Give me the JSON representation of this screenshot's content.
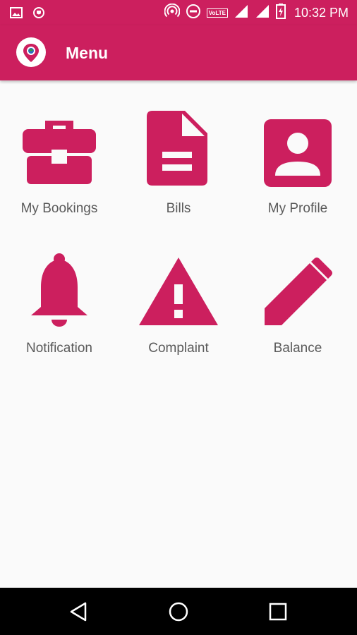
{
  "status_bar": {
    "time": "10:32 PM",
    "network_badge": "VoLTE",
    "icons": [
      "image-icon",
      "shield-icon",
      "hotspot-icon",
      "dnd-icon",
      "signal-icon",
      "signal-icon",
      "battery-charging-icon"
    ]
  },
  "app_bar": {
    "title": "Menu",
    "logo_icon": "location-pin-globe-icon"
  },
  "menu": {
    "items": [
      {
        "label": "My Bookings",
        "icon": "briefcase-icon"
      },
      {
        "label": "Bills",
        "icon": "document-icon"
      },
      {
        "label": "My Profile",
        "icon": "account-box-icon"
      },
      {
        "label": "Notification",
        "icon": "bell-icon"
      },
      {
        "label": "Complaint",
        "icon": "warning-icon"
      },
      {
        "label": "Balance",
        "icon": "pencil-icon"
      }
    ]
  },
  "nav_bar": {
    "buttons": [
      "back-icon",
      "home-icon",
      "recents-icon"
    ]
  },
  "colors": {
    "primary": "#cc1f5e",
    "background": "#fafafa",
    "label": "#5a5a5a"
  }
}
